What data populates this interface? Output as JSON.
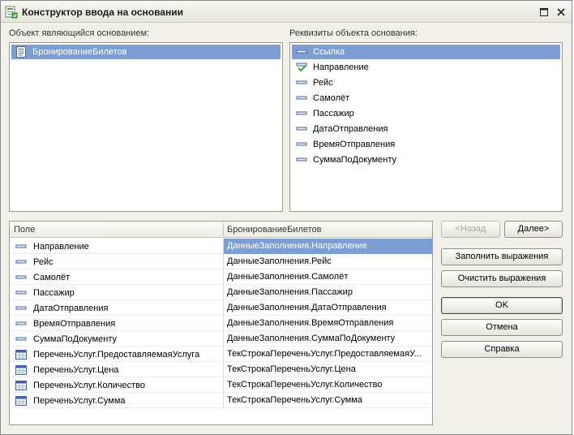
{
  "window": {
    "title": "Конструктор ввода на основании"
  },
  "left_panel": {
    "label": "Объект являющийся основанием:",
    "items": [
      {
        "label": "БронированиеБилетов",
        "icon": "document-icon",
        "selected": true
      }
    ]
  },
  "right_panel": {
    "label": "Реквизиты объекта основания:",
    "items": [
      {
        "label": "Ссылка",
        "icon": "attribute-icon",
        "selected": true
      },
      {
        "label": "Направление",
        "icon": "checked-attribute-icon"
      },
      {
        "label": "Рейс",
        "icon": "attribute-icon"
      },
      {
        "label": "Самолёт",
        "icon": "attribute-icon"
      },
      {
        "label": "Пассажир",
        "icon": "attribute-icon"
      },
      {
        "label": "ДатаОтправления",
        "icon": "attribute-icon"
      },
      {
        "label": "ВремяОтправления",
        "icon": "attribute-icon"
      },
      {
        "label": "СуммаПоДокументу",
        "icon": "attribute-icon"
      }
    ]
  },
  "grid": {
    "columns": [
      "Поле",
      "БронированиеБилетов"
    ],
    "rows": [
      {
        "field": "Направление",
        "expr": "ДанныеЗаполнения.Направление",
        "icon": "attribute-icon",
        "selected": true
      },
      {
        "field": "Рейс",
        "expr": "ДанныеЗаполнения.Рейс",
        "icon": "attribute-icon"
      },
      {
        "field": "Самолёт",
        "expr": "ДанныеЗаполнения.Самолёт",
        "icon": "attribute-icon"
      },
      {
        "field": "Пассажир",
        "expr": "ДанныеЗаполнения.Пассажир",
        "icon": "attribute-icon"
      },
      {
        "field": "ДатаОтправления",
        "expr": "ДанныеЗаполнения.ДатаОтправления",
        "icon": "attribute-icon"
      },
      {
        "field": "ВремяОтправления",
        "expr": "ДанныеЗаполнения.ВремяОтправления",
        "icon": "attribute-icon"
      },
      {
        "field": "СуммаПоДокументу",
        "expr": "ДанныеЗаполнения.СуммаПоДокументу",
        "icon": "attribute-icon"
      },
      {
        "field": "ПереченьУслуг.ПредоставляемаяУслуга",
        "expr": "ТекСтрокаПереченьУслуг.ПредоставляемаяУ...",
        "icon": "table-attribute-icon"
      },
      {
        "field": "ПереченьУслуг.Цена",
        "expr": "ТекСтрокаПереченьУслуг.Цена",
        "icon": "table-attribute-icon"
      },
      {
        "field": "ПереченьУслуг.Количество",
        "expr": "ТекСтрокаПереченьУслуг.Количество",
        "icon": "table-attribute-icon"
      },
      {
        "field": "ПереченьУслуг.Сумма",
        "expr": "ТекСтрокаПереченьУслуг.Сумма",
        "icon": "table-attribute-icon"
      }
    ]
  },
  "buttons": {
    "back": "<Назад",
    "next": "Далее>",
    "fill_expressions": "Заполнить выражения",
    "clear_expressions": "Очистить выражения",
    "ok": "OK",
    "cancel": "Отмена",
    "help": "Справка"
  },
  "colors": {
    "selection": "#7d9ed2",
    "window_bg": "#f1f1ea"
  }
}
